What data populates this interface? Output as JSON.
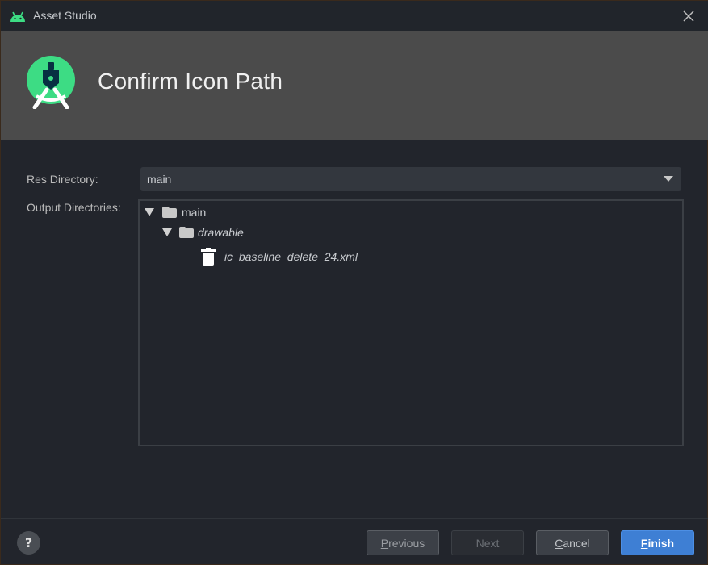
{
  "window": {
    "title": "Asset Studio"
  },
  "banner": {
    "heading": "Confirm Icon Path"
  },
  "form": {
    "res_directory_label": "Res Directory:",
    "res_directory_value": "main",
    "output_directories_label": "Output Directories:"
  },
  "tree": {
    "root": "main",
    "child": "drawable",
    "file": "ic_baseline_delete_24.xml"
  },
  "footer": {
    "help_label": "?",
    "previous_first": "P",
    "previous_rest": "revious",
    "next_label": "Next",
    "cancel_first": "C",
    "cancel_rest": "ancel",
    "finish_first": "F",
    "finish_rest": "inish"
  },
  "colors": {
    "accent": "#3e7fd4",
    "android_green": "#3ddc84",
    "banner_bg": "#4b4b4b"
  },
  "icons": [
    "android-icon",
    "close-icon",
    "android-studio-logo",
    "chevron-down-icon",
    "expand-triangle-icon",
    "folder-icon",
    "trash-icon",
    "help-icon"
  ]
}
